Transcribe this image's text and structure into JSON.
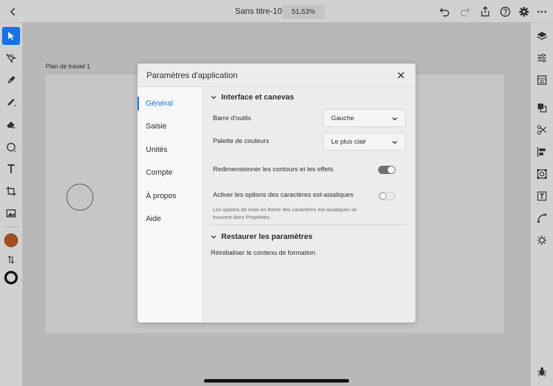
{
  "topbar": {
    "doc_title": "Sans titre-10",
    "zoom": "51,53%"
  },
  "canvas": {
    "artboard_label": "Plan de travail 1"
  },
  "colors": {
    "accent": "#1473e6",
    "fill": "#a3501e",
    "stroke": "#111111"
  },
  "modal": {
    "title": "Paramètres d'application",
    "nav": [
      "Général",
      "Saisie",
      "Unités",
      "Compte",
      "À propos",
      "Aide"
    ],
    "active_nav": "Général",
    "interface_section": {
      "title": "Interface et canevas",
      "toolbar_label": "Barre d'outils",
      "toolbar_value": "Gauche",
      "palette_label": "Palette de couleurs",
      "palette_value": "Le plus clair",
      "resize_label": "Redimensionner les contours et les effets",
      "resize_on": true,
      "asian_label": "Activer les options des caractères est-asiatiques",
      "asian_on": false,
      "asian_help": "Les options de mise en forme des caractères est-asiatiques se trouvent dans Propriétés."
    },
    "restore_section": {
      "title": "Restaurer les paramètres",
      "reset_label": "Réinitialiser le contenu de formation"
    }
  }
}
